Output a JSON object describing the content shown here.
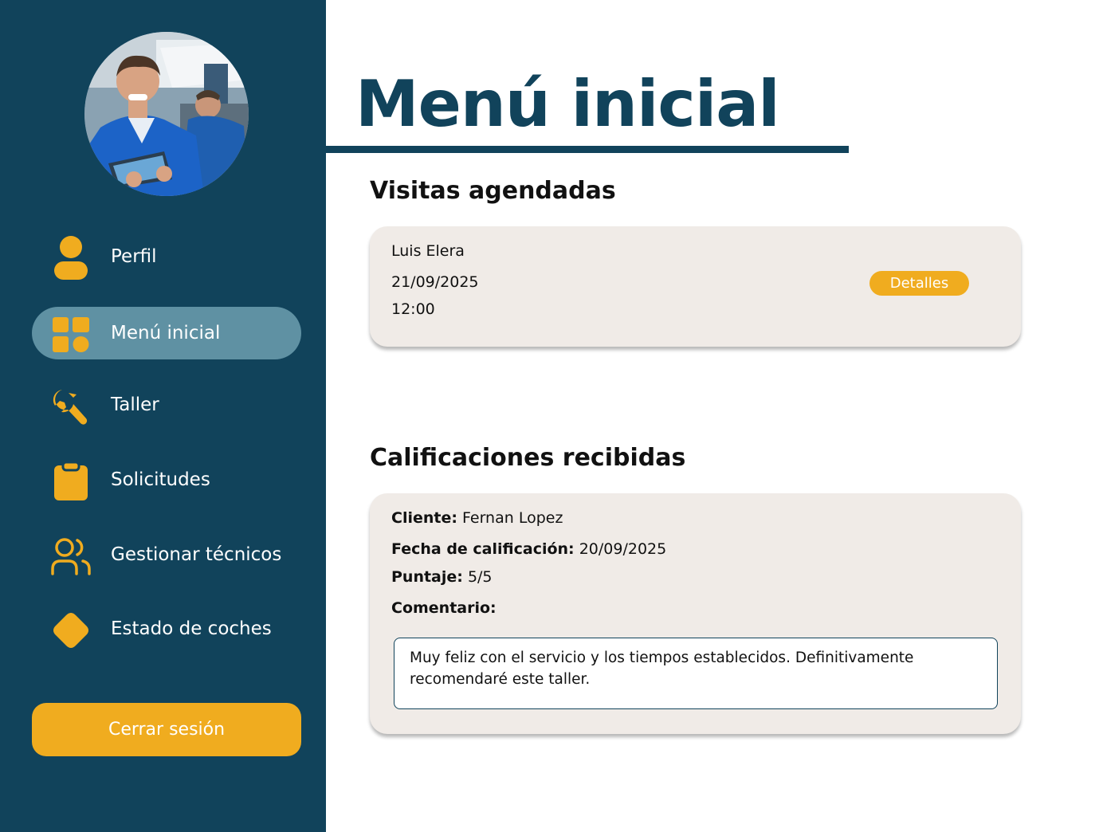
{
  "profile": {
    "avatar_alt": "Mecánico con tablet"
  },
  "sidebar": {
    "items": [
      {
        "label": "Perfil",
        "icon": "user-icon",
        "active": false
      },
      {
        "label": "Menú inicial",
        "icon": "grid-icon",
        "active": true
      },
      {
        "label": "Taller",
        "icon": "wrench-icon",
        "active": false
      },
      {
        "label": "Solicitudes",
        "icon": "clipboard-icon",
        "active": false
      },
      {
        "label": "Gestionar técnicos",
        "icon": "users-icon",
        "active": false
      },
      {
        "label": "Estado de coches",
        "icon": "diamond-icon",
        "active": false
      }
    ],
    "logout_label": "Cerrar sesión"
  },
  "main": {
    "title": "Menú inicial",
    "visits": {
      "section_title": "Visitas agendadas",
      "items": [
        {
          "name": "Luis Elera",
          "date": "21/09/2025",
          "time": "12:00",
          "details_label": "Detalles"
        }
      ]
    },
    "ratings": {
      "section_title": "Calificaciones recibidas",
      "items": [
        {
          "client_label": "Cliente:",
          "client": "Fernan Lopez",
          "date_label": "Fecha de calificación:",
          "date": "20/09/2025",
          "score_label": "Puntaje:",
          "score": "5/5",
          "comment_label": "Comentario:",
          "comment": "Muy feliz con el servicio y los tiempos establecidos. Definitivamente recomendaré este taller."
        }
      ]
    }
  },
  "colors": {
    "sidebar_bg": "#11435b",
    "active_item_bg": "#5f91a3",
    "accent": "#f0ac1f",
    "card_bg": "#f0ebe7",
    "title_color": "#11435b"
  }
}
